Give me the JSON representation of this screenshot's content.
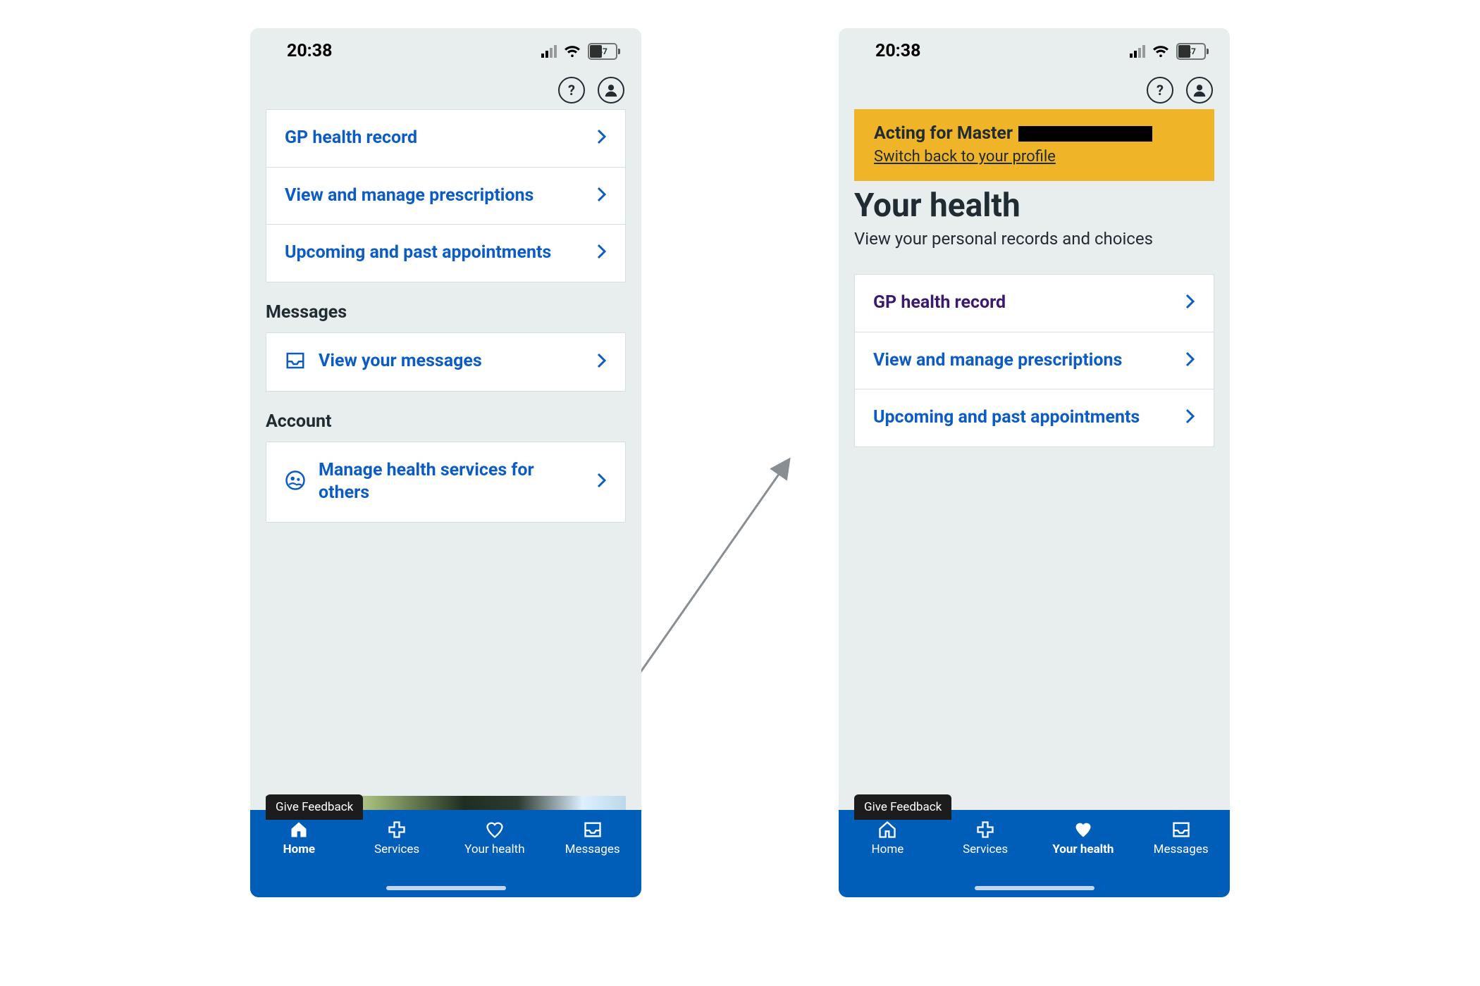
{
  "status": {
    "time": "20:38",
    "battery": "47"
  },
  "header": {
    "help": "?",
    "profile": ""
  },
  "phone1": {
    "health_links": [
      {
        "label": "GP health record"
      },
      {
        "label": "View and manage prescriptions"
      },
      {
        "label": "Upcoming and past appointments"
      }
    ],
    "sections": {
      "messages_title": "Messages",
      "messages_link": "View your messages",
      "account_title": "Account",
      "account_link": "Manage health services for others"
    },
    "feedback": "Give Feedback",
    "nav_active": "Home"
  },
  "phone2": {
    "banner": {
      "prefix": "Acting for Master",
      "switch": "Switch back to your profile"
    },
    "title": "Your health",
    "subtitle": "View your personal records and choices",
    "health_links": [
      {
        "label": "GP health record",
        "visited": true
      },
      {
        "label": "View and manage prescriptions"
      },
      {
        "label": "Upcoming and past appointments"
      }
    ],
    "feedback": "Give Feedback",
    "nav_active": "Your health"
  },
  "nav": [
    {
      "label": "Home"
    },
    {
      "label": "Services"
    },
    {
      "label": "Your health"
    },
    {
      "label": "Messages"
    }
  ]
}
